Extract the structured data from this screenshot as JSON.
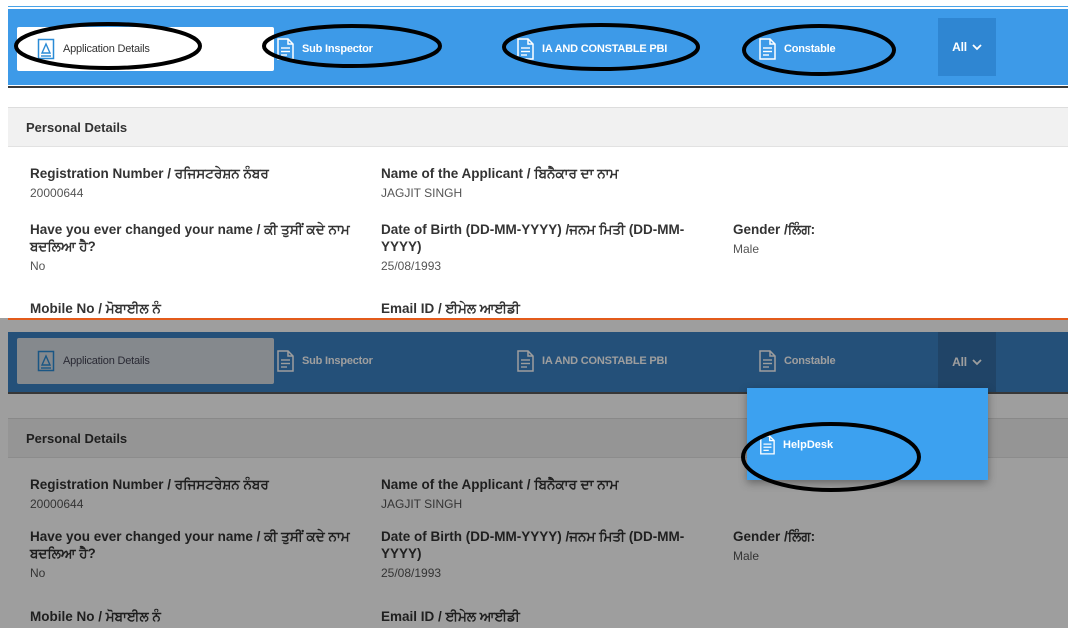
{
  "tabs": {
    "application_details": "Application Details",
    "sub_inspector": "Sub Inspector",
    "ia_constable_pbi": "IA AND CONSTABLE PBI",
    "constable": "Constable",
    "all": "All"
  },
  "section_title": "Personal Details",
  "fields": {
    "registration_number": {
      "label": "Registration Number / ਰਜਿਸਟਰੇਸ਼ਨ ਨੰਬਰ",
      "value": "20000644"
    },
    "applicant_name": {
      "label": "Name of the Applicant / ਬਿਨੈਕਾਰ ਦਾ ਨਾਮ",
      "value": "JAGJIT SINGH"
    },
    "name_changed": {
      "label": "Have you ever changed your name / ਕੀ ਤੁਸੀਂ ਕਦੇ ਨਾਮ ਬਦਲਿਆ ਹੈ?",
      "value": "No"
    },
    "date_of_birth": {
      "label": "Date of Birth (DD-MM-YYYY) /ਜਨਮ ਮਿਤੀ (DD-MM-YYYY)",
      "value": "25/08/1993"
    },
    "gender": {
      "label": "Gender /ਲਿੰਗ:",
      "value": "Male"
    },
    "mobile_no": {
      "label": "Mobile No / ਮੋਬਾਈਲ ਨੰ",
      "value": ""
    },
    "email_id": {
      "label": "Email ID / ਈਮੇਲ ਆਈਡੀ",
      "value": ""
    }
  },
  "dropdown": {
    "items": [
      "HelpDesk"
    ]
  },
  "colors": {
    "nav_blue": "#3d9ae8",
    "nav_blue_dimmed": "#3b82c4",
    "dropdown_blue": "#3ca1f0",
    "annotation": "#000000",
    "divider_orange": "#e25b1b"
  },
  "icons": {
    "tab_application": "form-document-icon",
    "tab_generic": "document-icon",
    "dropdown_item": "document-icon",
    "all_caret": "chevron-down-icon"
  }
}
